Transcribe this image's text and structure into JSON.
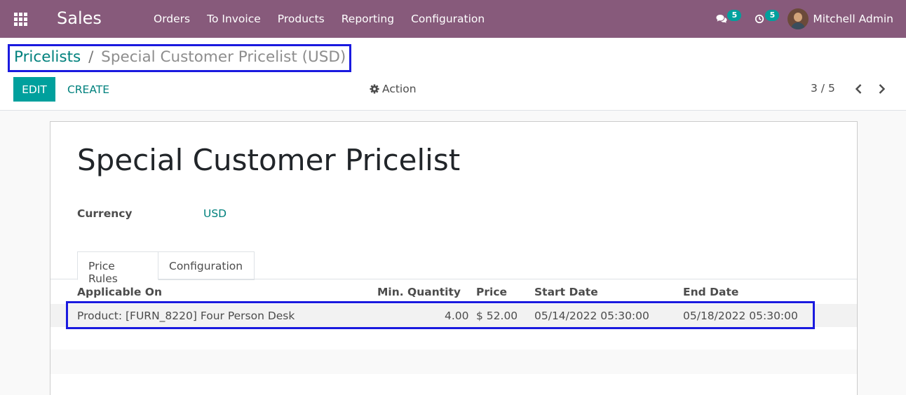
{
  "navbar": {
    "app_name": "Sales",
    "menu": [
      "Orders",
      "To Invoice",
      "Products",
      "Reporting",
      "Configuration"
    ],
    "messages_count": "5",
    "activities_count": "5",
    "user_name": "Mitchell Admin",
    "bg_color": "#875a7b",
    "badge_color": "#00a09d"
  },
  "breadcrumb": {
    "parent": "Pricelists",
    "separator": "/",
    "current": "Special Customer Pricelist (USD)"
  },
  "toolbar": {
    "edit_label": "EDIT",
    "create_label": "CREATE",
    "action_label": "Action",
    "pager_text": "3 / 5"
  },
  "form": {
    "title": "Special Customer Pricelist",
    "currency_label": "Currency",
    "currency_value": "USD"
  },
  "tabs": [
    {
      "label": "Price Rules",
      "active": true
    },
    {
      "label": "Configuration",
      "active": false
    }
  ],
  "table": {
    "columns": [
      "Applicable On",
      "Min. Quantity",
      "Price",
      "Start Date",
      "End Date"
    ],
    "rows": [
      {
        "applicable_on": "Product: [FURN_8220] Four Person Desk",
        "min_quantity": "4.00",
        "price": "$ 52.00",
        "start_date": "05/14/2022 05:30:00",
        "end_date": "05/18/2022 05:30:00"
      }
    ]
  },
  "icons": [
    "apps-grid-icon",
    "chat-icon",
    "clock-icon",
    "gear-icon",
    "chevron-left-icon",
    "chevron-right-icon"
  ],
  "colors": {
    "primary": "#00a09d",
    "link": "#00817d",
    "annotation_box": "#1a1adf"
  }
}
